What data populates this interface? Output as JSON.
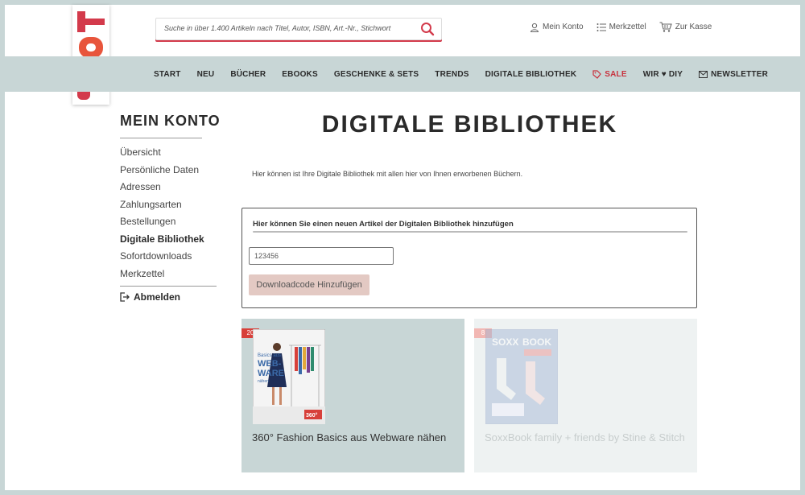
{
  "logo": {
    "text": "TOPP"
  },
  "search": {
    "placeholder": "Suche in über 1.400 Artikeln nach Titel, Autor, ISBN, Art.-Nr., Stichwort"
  },
  "top_links": [
    {
      "label": "Mein Konto",
      "icon": "user-icon"
    },
    {
      "label": "Merkzettel",
      "icon": "list-icon"
    },
    {
      "label": "Zur Kasse",
      "icon": "cart-icon"
    }
  ],
  "nav": [
    {
      "label": "START"
    },
    {
      "label": "NEU"
    },
    {
      "label": "BÜCHER"
    },
    {
      "label": "EBOOKS"
    },
    {
      "label": "GESCHENKE & SETS"
    },
    {
      "label": "TRENDS"
    },
    {
      "label": "DIGITALE BIBLIOTHEK"
    },
    {
      "label": "SALE",
      "icon": "tag-icon"
    },
    {
      "label": "WIR ♥ DIY"
    },
    {
      "label": "NEWSLETTER",
      "icon": "mail-icon"
    }
  ],
  "sidebar": {
    "title": "MEIN KONTO",
    "items": [
      {
        "label": "Übersicht"
      },
      {
        "label": "Persönliche Daten"
      },
      {
        "label": "Adressen"
      },
      {
        "label": "Zahlungsarten"
      },
      {
        "label": "Bestellungen"
      },
      {
        "label": "Digitale Bibliothek",
        "active": true
      },
      {
        "label": "Sofortdownloads"
      },
      {
        "label": "Merkzettel"
      }
    ],
    "logout": "Abmelden"
  },
  "main": {
    "title": "DIGITALE BIBLIOTHEK",
    "intro": "Hier können ist Ihre Digitale Bibliothek mit allen hier von Ihnen erworbenen Büchern.",
    "add_box": {
      "title": "Hier können Sie einen neuen Artikel der Digitalen Bibliothek hinzufügen",
      "input_value": "123456",
      "button": "Downloadcode Hinzufügen"
    },
    "books": [
      {
        "badge": "20",
        "title": "360° Fashion Basics aus Webware nähen",
        "cover_text": [
          "Basics aus",
          "WEB-",
          "WARE",
          "nähen",
          "360°"
        ]
      },
      {
        "badge": "8",
        "title": "SoxxBook family + friends by Stine & Stitch",
        "cover_text": [
          "SOXX",
          "BOOK"
        ]
      }
    ]
  },
  "colors": {
    "accent": "#d33a4b",
    "band": "#c8d6d6",
    "button": "#e3c9c3"
  }
}
